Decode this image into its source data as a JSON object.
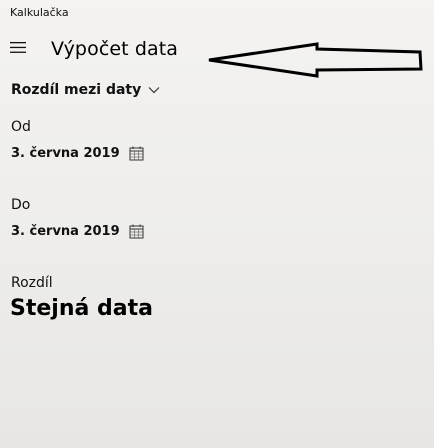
{
  "window": {
    "title": "Kalkulačka"
  },
  "header": {
    "menu_icon": "hamburger-icon",
    "mode_title": "Výpočet data"
  },
  "annotation": {
    "icon": "arrow-left-icon"
  },
  "mode_selector": {
    "selected": "Rozdíl mezi daty",
    "icon": "chevron-down-icon"
  },
  "from": {
    "label": "Od",
    "date": "3. června 2019",
    "icon": "calendar-icon"
  },
  "to": {
    "label": "Do",
    "date": "3. června 2019",
    "icon": "calendar-icon"
  },
  "result": {
    "label": "Rozdíl",
    "value": "Stejná data"
  }
}
